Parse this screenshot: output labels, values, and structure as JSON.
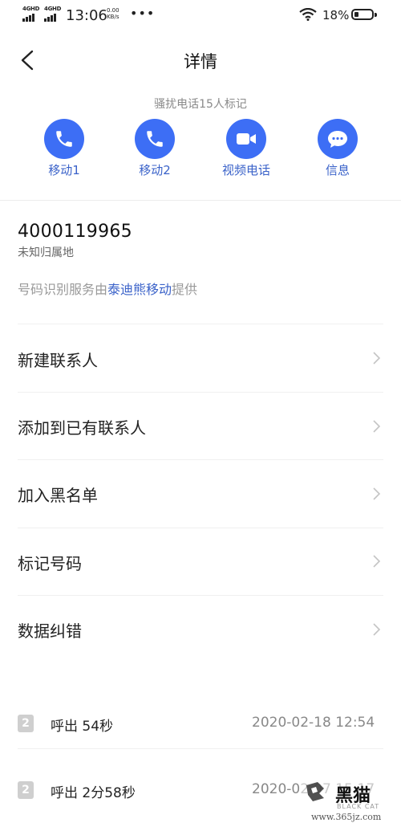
{
  "status_bar": {
    "sim1": "4GHD",
    "sim2": "4GHD",
    "time": "13:06",
    "net_speed_value": "0.00",
    "net_speed_unit": "KB/s",
    "more": "•••",
    "battery": "18%"
  },
  "header": {
    "title": "详情"
  },
  "spam_notice": "骚扰电话15人标记",
  "actions": [
    {
      "label": "移动1",
      "icon": "phone-icon"
    },
    {
      "label": "移动2",
      "icon": "phone-icon"
    },
    {
      "label": "视频电话",
      "icon": "video-camera-icon"
    },
    {
      "label": "信息",
      "icon": "message-bubble-icon"
    }
  ],
  "accent_color": "#3d6ef5",
  "contact": {
    "number": "4000119965",
    "location": "未知归属地",
    "provider_prefix": "号码识别服务由",
    "provider_name": "泰迪熊移动",
    "provider_suffix": "提供"
  },
  "menu": [
    {
      "label": "新建联系人"
    },
    {
      "label": "添加到已有联系人"
    },
    {
      "label": "加入黑名单"
    },
    {
      "label": "标记号码"
    },
    {
      "label": "数据纠错"
    }
  ],
  "call_log": [
    {
      "sim": "2",
      "type_duration": "呼出 54秒",
      "datetime": "2020-02-18 12:54"
    },
    {
      "sim": "2",
      "type_duration": "呼出 2分58秒",
      "datetime": "2020-02-07 15:17"
    }
  ],
  "watermark": {
    "url": "www.365jz.com",
    "brand": "BLACK CAT"
  }
}
